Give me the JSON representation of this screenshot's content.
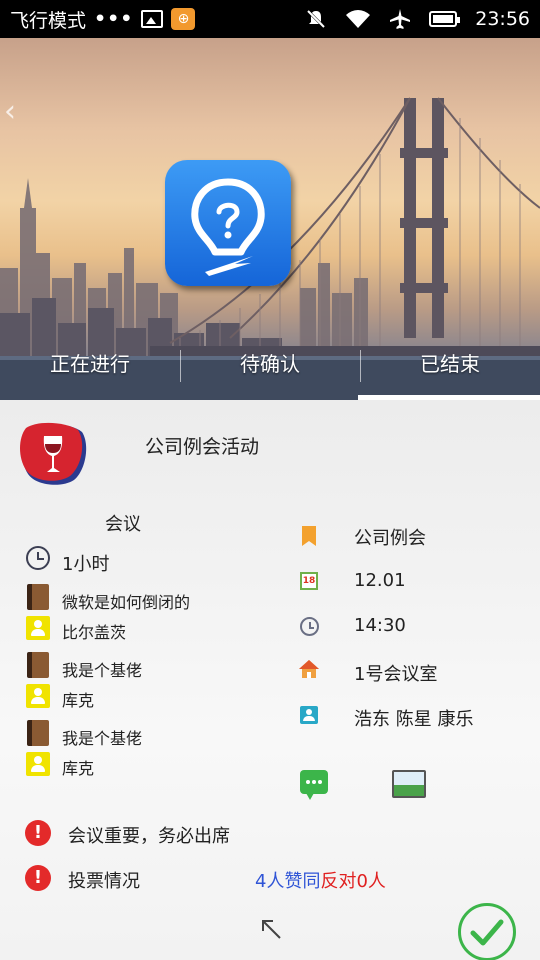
{
  "status_bar": {
    "mode": "飞行模式",
    "time": "23:56",
    "icons": [
      "gallery-icon",
      "game-icon",
      "mute-icon",
      "wifi-icon",
      "airplane-icon",
      "battery-icon"
    ]
  },
  "header": {
    "back_icon": "chevron-left-icon",
    "app_icon": "lightbulb-question-icon"
  },
  "tabs": [
    {
      "label": "正在进行",
      "active": false
    },
    {
      "label": "待确认",
      "active": false
    },
    {
      "label": "已结束",
      "active": true
    }
  ],
  "event": {
    "title": "公司例会活动",
    "left": {
      "type": "会议",
      "duration": "1小时",
      "agenda": [
        {
          "topic": "微软是如何倒闭的",
          "speaker": "比尔盖茨"
        },
        {
          "topic": "我是个基佬",
          "speaker": "库克"
        },
        {
          "topic": "我是个基佬",
          "speaker": "库克"
        }
      ]
    },
    "right": {
      "category": "公司例会",
      "date": "12.01",
      "calendar_day": "18",
      "time": "14:30",
      "location": "1号会议室",
      "participants": "浩东 陈星 康乐"
    },
    "notice": "会议重要，务必出席",
    "vote_label": "投票情况",
    "vote_agree": "4人赞同",
    "vote_oppose": "反对0人"
  },
  "colors": {
    "accent_green": "#3cb54a",
    "warning_red": "#e32a2a",
    "agree_blue": "#2f54d6",
    "oppose_red": "#e02020"
  }
}
